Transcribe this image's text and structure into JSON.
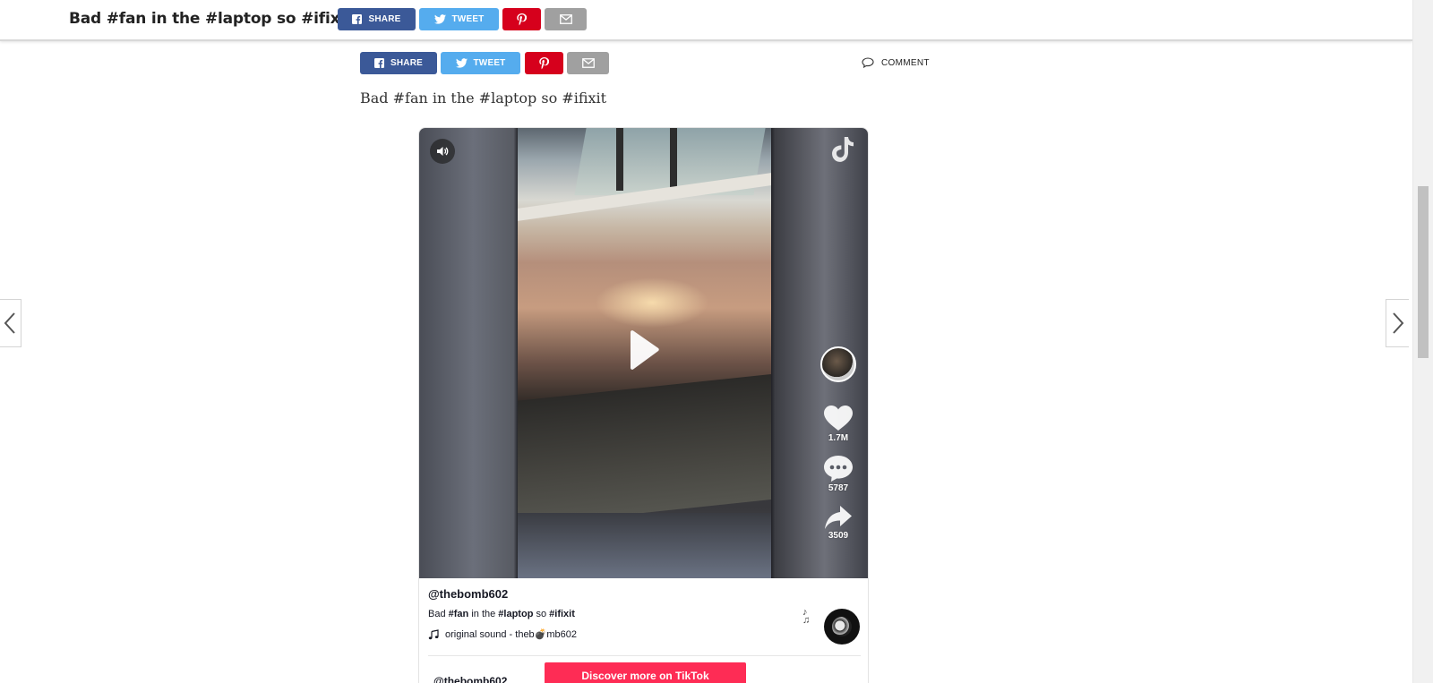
{
  "header": {
    "title": "Bad #fan in the #laptop so #ifixit",
    "share_label": "SHARE",
    "tweet_label": "TWEET"
  },
  "article": {
    "share_label": "SHARE",
    "tweet_label": "TWEET",
    "comment_label": "COMMENT",
    "body_text": "Bad #fan in the #laptop so #ifixit"
  },
  "embed": {
    "author": "@thebomb602",
    "caption_parts": {
      "bad": "Bad ",
      "tag_fan": "#fan",
      "in_the": " in the ",
      "tag_laptop": "#laptop",
      "so": " so ",
      "tag_ifixit": "#ifixit"
    },
    "sound": "original sound - theb💣mb602",
    "likes": "1.7M",
    "comments": "5787",
    "shares": "3509",
    "next_author": "@thebomb602",
    "watch_button": "Discover more on TikTok"
  },
  "colors": {
    "facebook": "#3b5998",
    "twitter": "#55acee",
    "pinterest": "#d6001c",
    "email": "#a0a0a0",
    "tiktok_pink": "#fe2c55"
  },
  "icons": [
    "facebook-icon",
    "twitter-icon",
    "pinterest-icon",
    "email-icon",
    "comment-icon",
    "volume-icon",
    "tiktok-logo-icon",
    "play-icon",
    "heart-icon",
    "comment-bubble-icon",
    "share-arrow-icon",
    "music-note-icon",
    "chevron-left-icon",
    "chevron-right-icon"
  ]
}
